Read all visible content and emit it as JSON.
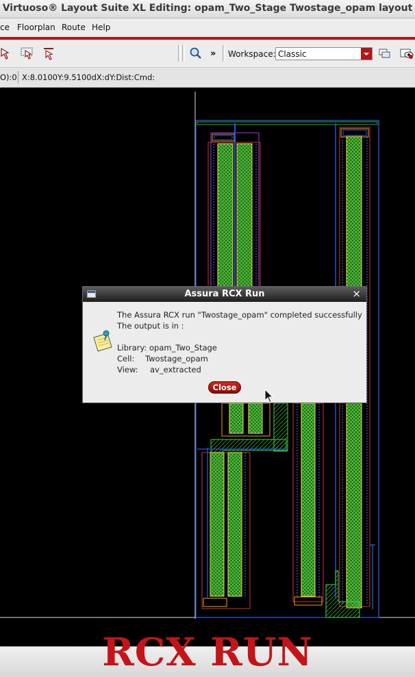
{
  "window": {
    "title": "Virtuoso® Layout Suite XL Editing: opam_Two_Stage Twostage_opam layout"
  },
  "menubar": {
    "items": [
      "ce",
      "Floorplan",
      "Route",
      "Help"
    ]
  },
  "toolbar": {
    "workspace_label": "Workspace:",
    "workspace_value": "Classic",
    "more_label": "»"
  },
  "coordbar": {
    "prefix": "O):0",
    "readout": "X:8.0100Y:9.5100dX:dY:Dist:Cmd:"
  },
  "dialog": {
    "title": "Assura RCX Run",
    "close_x": "×",
    "line1": "The Assura RCX run \"Twostage_opam\" completed successfully",
    "line2": "The output is in :",
    "library_label": "Library:",
    "library_value": "opam_Two_Stage",
    "cell_label": "Cell:",
    "cell_value": "Twostage_opam",
    "view_label": "View:",
    "view_value": "av_extracted",
    "close_button": "Close"
  },
  "caption": "RCX RUN"
}
